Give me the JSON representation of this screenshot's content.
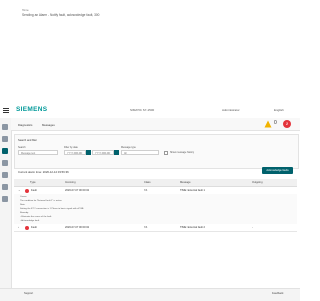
{
  "window": {
    "top_text": "Home",
    "title": "Sending an Alarm - Notify fault, acknowledge fault, 300"
  },
  "header": {
    "logo": "SIEMENS",
    "center_text": "SIMATIC S7-1500",
    "user": "Administrator",
    "lang": "English"
  },
  "sidebar": {
    "items": [
      "home-icon",
      "station-icon",
      "alarm-icon",
      "diagnostics-icon",
      "data-logs-icon",
      "user-icon",
      "settings-icon"
    ]
  },
  "subheader": {
    "path_1": "Diagnostics",
    "path_2": "Messages",
    "warning_count": "0",
    "error_count": "2"
  },
  "filter": {
    "title": "Search and filter",
    "search_label": "Search",
    "search_placeholder": "Message text",
    "date_label": "Filter by date",
    "date_from": "YYYY-MM-DD",
    "date_to": "YYYY-MM-DD",
    "type_label": "Message type",
    "type_value": "All",
    "checkbox_label": "Show message history"
  },
  "current_alarms": "Current alarm time: 2026-12-12 03:56:36",
  "ack_button": "Acknowledge faults",
  "table": {
    "headers": [
      "Type",
      "Incoming",
      "Class",
      "Message",
      "Outgoing"
    ],
    "rows": [
      {
        "type": "Fault",
        "incoming": "2026-07-07 00:00:02",
        "class": "7A",
        "message": "TIME: External fault 1",
        "outgoing": ""
      },
      {
        "type": "Fault",
        "incoming": "2026-07-07 00:00:02",
        "class": "7A",
        "message": "TIME: External fault 2",
        "outgoing": "-"
      }
    ],
    "detail_lines": [
      "Cause:",
      "The condition for \"External fault 1\" is active.",
      "Note:",
      "Setting the ET 2 connection is 1 Phase to basic signal with eP BB.",
      "Remedy:",
      "- Eliminate the cause of the fault.",
      "- Acknowledge fault."
    ]
  },
  "footer": {
    "left": "Support",
    "right": "Feedback"
  },
  "colors": {
    "accent": "#00616c",
    "brand": "#009999",
    "error": "#e4343c"
  }
}
